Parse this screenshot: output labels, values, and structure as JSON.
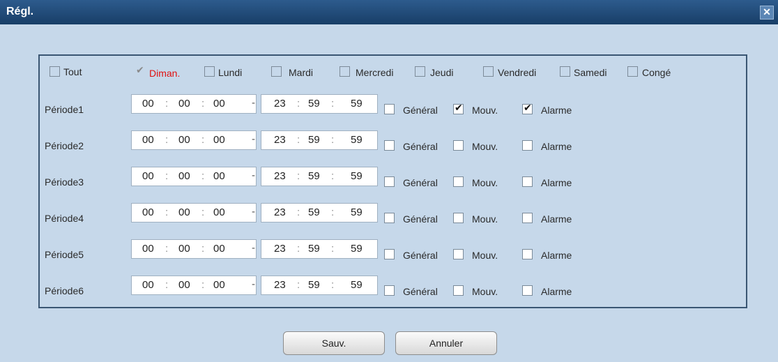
{
  "window": {
    "title": "Régl.",
    "close_symbol": "✕"
  },
  "days": [
    {
      "label": "Tout",
      "checked": false
    },
    {
      "label": "Diman.",
      "checked": true
    },
    {
      "label": "Lundi",
      "checked": false
    },
    {
      "label": "Mardi",
      "checked": false
    },
    {
      "label": "Mercredi",
      "checked": false
    },
    {
      "label": "Jeudi",
      "checked": false
    },
    {
      "label": "Vendredi",
      "checked": false
    },
    {
      "label": "Samedi",
      "checked": false
    },
    {
      "label": "Congé",
      "checked": false
    }
  ],
  "periods": [
    {
      "label": "Période1",
      "start": [
        "00",
        "00",
        "00"
      ],
      "end": [
        "23",
        "59",
        "59"
      ],
      "general": false,
      "mouv": true,
      "alarme": true
    },
    {
      "label": "Période2",
      "start": [
        "00",
        "00",
        "00"
      ],
      "end": [
        "23",
        "59",
        "59"
      ],
      "general": false,
      "mouv": false,
      "alarme": false
    },
    {
      "label": "Période3",
      "start": [
        "00",
        "00",
        "00"
      ],
      "end": [
        "23",
        "59",
        "59"
      ],
      "general": false,
      "mouv": false,
      "alarme": false
    },
    {
      "label": "Période4",
      "start": [
        "00",
        "00",
        "00"
      ],
      "end": [
        "23",
        "59",
        "59"
      ],
      "general": false,
      "mouv": false,
      "alarme": false
    },
    {
      "label": "Période5",
      "start": [
        "00",
        "00",
        "00"
      ],
      "end": [
        "23",
        "59",
        "59"
      ],
      "general": false,
      "mouv": false,
      "alarme": false
    },
    {
      "label": "Période6",
      "start": [
        "00",
        "00",
        "00"
      ],
      "end": [
        "23",
        "59",
        "59"
      ],
      "general": false,
      "mouv": false,
      "alarme": false
    }
  ],
  "event_labels": {
    "general": "Général",
    "mouv": "Mouv.",
    "alarme": "Alarme"
  },
  "time_separator": ":",
  "range_separator": "-",
  "buttons": {
    "save": "Sauv.",
    "cancel": "Annuler"
  }
}
